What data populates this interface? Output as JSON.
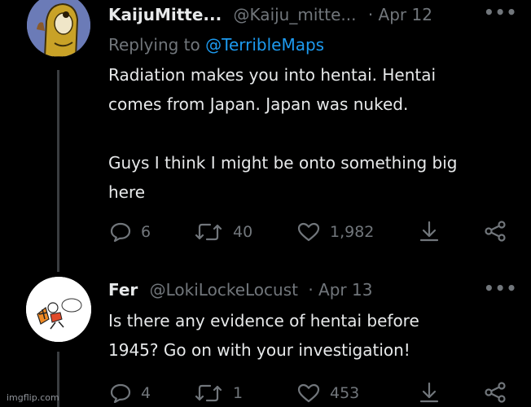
{
  "tweets": [
    {
      "display_name": "KaijuMitte...",
      "handle": "@Kaiju_mitte...",
      "date": "· Apr 12",
      "replying_prefix": "Replying to",
      "replying_to": "@TerribleMaps",
      "text": "Radiation makes you into hentai. Hentai\ncomes from Japan. Japan was nuked.\n\nGuys I think I might be onto something big\nhere",
      "replies": "6",
      "retweets": "40",
      "likes": "1,982",
      "more_icon": "more-icon"
    },
    {
      "display_name": "Fer",
      "handle": "@LokiLockeLocust",
      "date": "· Apr 13",
      "text": "Is there any evidence of hentai before\n1945? Go on with your investigation!",
      "replies": "4",
      "retweets": "1",
      "likes": "453",
      "more_icon": "more-icon"
    }
  ],
  "watermark": "imgflip.com",
  "colors": {
    "background": "#000000",
    "text": "#e7e9ea",
    "muted": "#71767b",
    "link": "#1d9bf0"
  }
}
